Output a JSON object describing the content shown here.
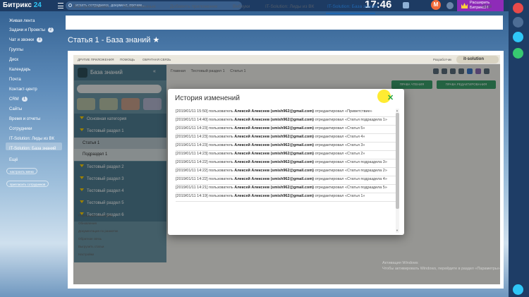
{
  "topbar": {
    "logo_main": "Битрикс",
    "logo_num": "24",
    "search_placeholder": "искать сотрудника, документ, прочее...",
    "time": "17:46",
    "avatar_letter": "M",
    "upgrade_line1": "Расширить",
    "upgrade_line2": "Битрикс24"
  },
  "sidebar": {
    "items": [
      {
        "label": "Живая лента",
        "badge": ""
      },
      {
        "label": "Задачи и Проекты",
        "badge": "2"
      },
      {
        "label": "Чат и звонки",
        "badge": "3"
      },
      {
        "label": "Группы",
        "badge": ""
      },
      {
        "label": "Диск",
        "badge": ""
      },
      {
        "label": "Календарь",
        "badge": ""
      },
      {
        "label": "Почта",
        "badge": ""
      },
      {
        "label": "Контакт-центр",
        "badge": ""
      },
      {
        "label": "CRM",
        "badge": "1"
      },
      {
        "label": "Сайты",
        "badge": ""
      },
      {
        "label": "Время и отчеты",
        "badge": ""
      },
      {
        "label": "Сотрудники",
        "badge": ""
      },
      {
        "label": "IT-Solution: Лиды из ВК",
        "badge": ""
      },
      {
        "label": "IT-Solution: База знаний",
        "badge": ""
      },
      {
        "label": "Ещё",
        "badge": ""
      }
    ],
    "btn_setup": "настроить меню",
    "btn_invite": "пригласить сотрудников"
  },
  "tabs": {
    "items": [
      "Все приложения",
      "Установленные",
      "Добавить приложение",
      "Вебхуки",
      "IT-Solution: Лиды из ВК",
      "IT-Solution: База знаний"
    ],
    "more": "Ещё"
  },
  "page": {
    "title": "Статья 1 - База знаний ★"
  },
  "app": {
    "top_links": [
      "ДРУГИЕ ПРИЛОЖЕНИЯ",
      "ПОМОЩЬ",
      "ОБРАТНАЯ СВЯЗЬ"
    ],
    "developer": "Разработчик",
    "brand": "it-solution",
    "kb_title": "База знаний",
    "breadcrumbs": [
      "Главная",
      "Тестовый раздел 1",
      "Статья 1"
    ],
    "btn_read": "ПРАВА ЧТЕНИЯ",
    "btn_edit": "ПРАВА РЕДАКТИРОВАНИЯ",
    "tree": [
      {
        "label": "Основная категория",
        "type": "section"
      },
      {
        "label": "Тестовый раздел 1",
        "type": "section"
      },
      {
        "label": "Статья 1",
        "type": "selected"
      },
      {
        "label": "Подраздел 1",
        "type": "sub"
      },
      {
        "label": "Тестовый раздел 2",
        "type": "section"
      },
      {
        "label": "Тестовый раздел 3",
        "type": "section"
      },
      {
        "label": "Тестовый раздел 4",
        "type": "section"
      },
      {
        "label": "Тестовый раздел 5",
        "type": "section"
      },
      {
        "label": "Тестовый раздел 6",
        "type": "section"
      }
    ],
    "bottom_links": [
      "Перемещать категории",
      "Обновления",
      "Документация по разметке",
      "Обратная связь",
      "Выгрузить статьи",
      "Настройки"
    ],
    "watermark1": "Активация Windows",
    "watermark2": "Чтобы активировать Windows, перейдите в раздел «Параметры»."
  },
  "modal": {
    "title": "История изменений",
    "entries": [
      {
        "ts": "[2019/01/11 15:50]",
        "pre": "пользователь",
        "user": "Алексей Алексеев (smish962@gmail.com)",
        "post": "отредактировал «Приветствие»"
      },
      {
        "ts": "[2019/01/11 14:40]",
        "pre": "пользователь",
        "user": "Алексей Алексеев (smish962@gmail.com)",
        "post": "отредактировал «Статья подраздела 1»"
      },
      {
        "ts": "[2019/01/11 14:23]",
        "pre": "пользователь",
        "user": "Алексей Алексеев (smish962@gmail.com)",
        "post": "отредактировал «Статья 5»"
      },
      {
        "ts": "[2019/01/11 14:23]",
        "pre": "пользователь",
        "user": "Алексей Алексеев (smish962@gmail.com)",
        "post": "отредактировал «Статья 4»"
      },
      {
        "ts": "[2019/01/11 14:23]",
        "pre": "пользователь",
        "user": "Алексей Алексеев (smish962@gmail.com)",
        "post": "отредактировал «Статья 3»"
      },
      {
        "ts": "[2019/01/11 14:23]",
        "pre": "пользователь",
        "user": "Алексей Алексеев (smish962@gmail.com)",
        "post": "отредактировал «Статья 2»"
      },
      {
        "ts": "[2019/01/11 14:22]",
        "pre": "пользователь",
        "user": "Алексей Алексеев (smish962@gmail.com)",
        "post": "отредактировал «Статья подраздела 3»"
      },
      {
        "ts": "[2019/01/11 14:22]",
        "pre": "пользователь",
        "user": "Алексей Алексеев (smish962@gmail.com)",
        "post": "отредактировал «Статья подраздела 2»"
      },
      {
        "ts": "[2019/01/11 14:22]",
        "pre": "пользователь",
        "user": "Алексей Алексеев (smish962@gmail.com)",
        "post": "отредактировал «Статья подраздела 4»"
      },
      {
        "ts": "[2019/01/11 14:21]",
        "pre": "пользователь",
        "user": "Алексей Алексеев (smish962@gmail.com)",
        "post": "отредактировал «Статья подраздела 5»"
      },
      {
        "ts": "[2019/01/11 14:19]",
        "pre": "пользователь",
        "user": "Алексей Алексеев (smish962@gmail.com)",
        "post": "отредактировал «Статья 1»"
      }
    ]
  },
  "colors": {
    "topbar": "#1d3b63",
    "accent": "#2067b0",
    "upgrade": "#8e2bb8",
    "kb_panel": "#4f7f93",
    "green": "#3aa06b"
  }
}
